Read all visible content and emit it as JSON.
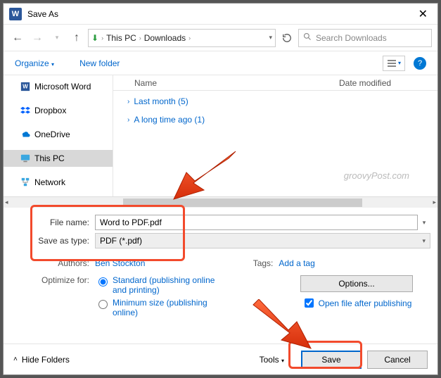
{
  "title": "Save As",
  "path": {
    "loc1": "This PC",
    "loc2": "Downloads"
  },
  "search": {
    "placeholder": "Search Downloads"
  },
  "toolbar": {
    "organize": "Organize",
    "newfolder": "New folder"
  },
  "sidebar": {
    "items": [
      {
        "label": "Microsoft Word",
        "icon": "word"
      },
      {
        "label": "Dropbox",
        "icon": "dropbox"
      },
      {
        "label": "OneDrive",
        "icon": "onedrive"
      },
      {
        "label": "This PC",
        "icon": "thispc",
        "selected": true
      },
      {
        "label": "Network",
        "icon": "network"
      }
    ]
  },
  "filelist": {
    "cols": {
      "name": "Name",
      "date": "Date modified"
    },
    "groups": [
      {
        "label": "Last month (5)"
      },
      {
        "label": "A long time ago (1)"
      }
    ]
  },
  "watermark": "groovyPost.com",
  "form": {
    "filename_label": "File name:",
    "filename_value": "Word to PDF.pdf",
    "type_label": "Save as type:",
    "type_value": "PDF (*.pdf)",
    "authors_label": "Authors:",
    "authors_value": "Ben Stockton",
    "tags_label": "Tags:",
    "tags_value": "Add a tag"
  },
  "optimize": {
    "label": "Optimize for:",
    "opt1": "Standard (publishing online and printing)",
    "opt2": "Minimum size (publishing online)",
    "options_btn": "Options...",
    "open_after": "Open file after publishing"
  },
  "footer": {
    "hide": "Hide Folders",
    "tools": "Tools",
    "save": "Save",
    "cancel": "Cancel"
  }
}
